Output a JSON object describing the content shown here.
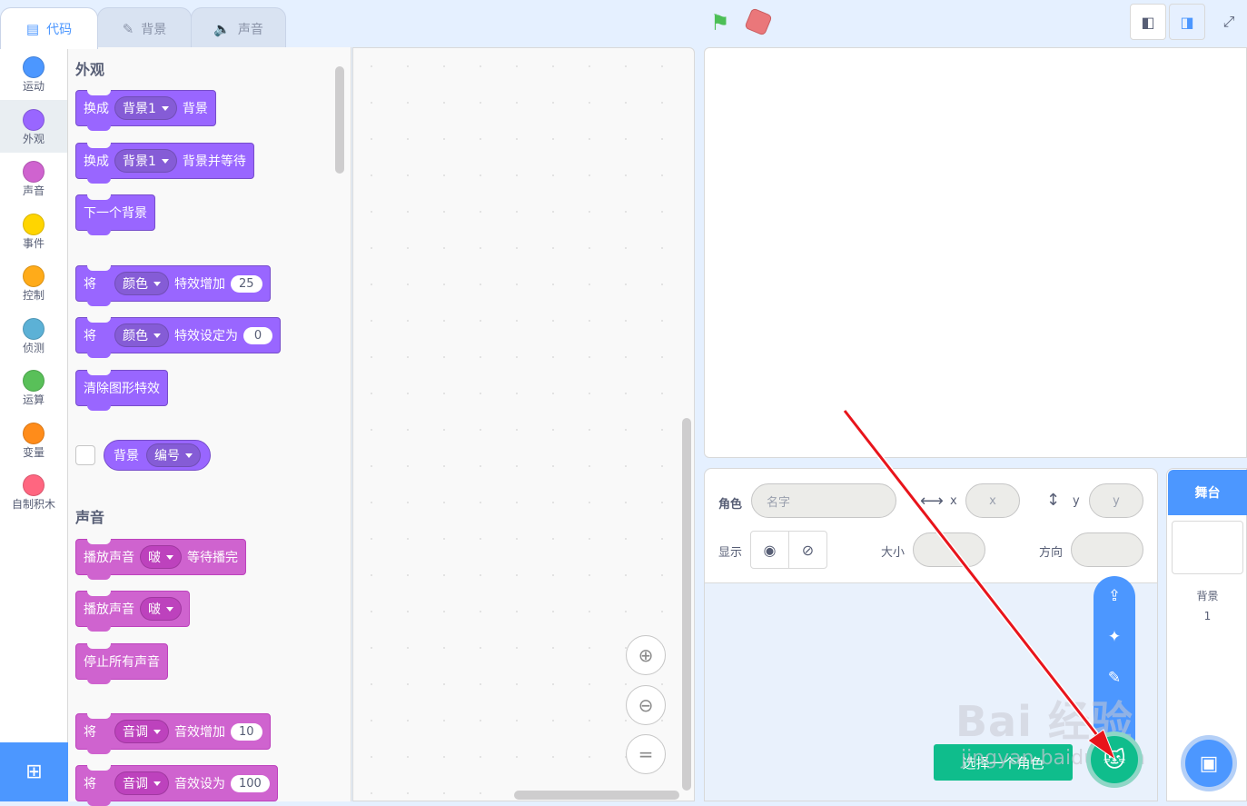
{
  "tabs": [
    {
      "label": "代码",
      "icon": "code-icon",
      "active": true
    },
    {
      "label": "背景",
      "icon": "brush-icon",
      "active": false
    },
    {
      "label": "声音",
      "icon": "speaker-icon",
      "active": false
    }
  ],
  "categories": [
    {
      "label": "运动",
      "color": "#4c97ff"
    },
    {
      "label": "外观",
      "color": "#9966ff"
    },
    {
      "label": "声音",
      "color": "#cf63cf"
    },
    {
      "label": "事件",
      "color": "#ffd500"
    },
    {
      "label": "控制",
      "color": "#ffab19"
    },
    {
      "label": "侦测",
      "color": "#5cb1d6"
    },
    {
      "label": "运算",
      "color": "#59c059"
    },
    {
      "label": "变量",
      "color": "#ff8c1a"
    },
    {
      "label": "自制积木",
      "color": "#ff6680"
    }
  ],
  "palette": {
    "looks_title": "外观",
    "looks_blocks": {
      "b1": {
        "pre": "换成",
        "drop": "背景1",
        "post": "背景"
      },
      "b2": {
        "pre": "换成",
        "drop": "背景1",
        "post": "背景并等待"
      },
      "b3": {
        "text": "下一个背景"
      },
      "b4": {
        "pre": "将",
        "drop": "颜色",
        "post": "特效增加",
        "num": "25"
      },
      "b5": {
        "pre": "将",
        "drop": "颜色",
        "post": "特效设定为",
        "num": "0"
      },
      "b6": {
        "text": "清除图形特效"
      },
      "reporter": {
        "text": "背景",
        "drop": "编号"
      }
    },
    "sound_title": "声音",
    "sound_blocks": {
      "s1": {
        "pre": "播放声音",
        "drop": "啵",
        "post": "等待播完"
      },
      "s2": {
        "pre": "播放声音",
        "drop": "啵"
      },
      "s3": {
        "text": "停止所有声音"
      },
      "s4": {
        "pre": "将",
        "drop": "音调",
        "post": "音效增加",
        "num": "10"
      },
      "s5": {
        "pre": "将",
        "drop": "音调",
        "post": "音效设为",
        "num": "100"
      }
    }
  },
  "sprite_info": {
    "sprite_label": "角色",
    "name_placeholder": "名字",
    "x_label": "x",
    "x_placeholder": "x",
    "y_label": "y",
    "y_placeholder": "y",
    "show_label": "显示",
    "size_label": "大小",
    "direction_label": "方向"
  },
  "sprite_menu": {
    "tooltip": "选择一个角色"
  },
  "stage_panel": {
    "header": "舞台",
    "backdrops_label": "背景",
    "backdrops_count": "1"
  },
  "watermark": {
    "logo": "Bai 经验",
    "url": "jingyan.baidu.com"
  }
}
